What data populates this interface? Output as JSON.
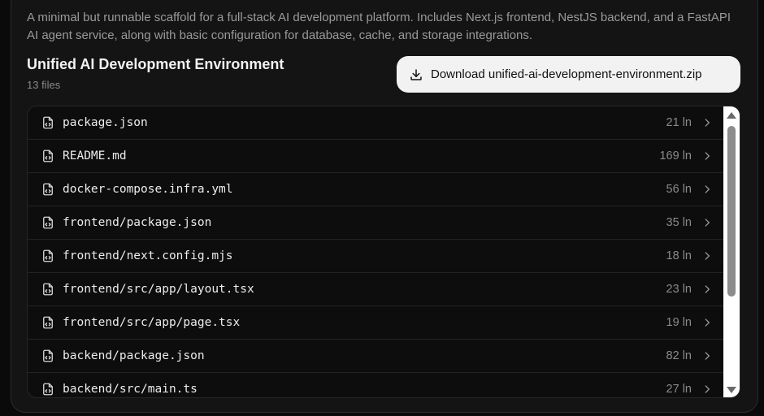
{
  "description": "A minimal but runnable scaffold for a full-stack AI development platform. Includes Next.js frontend, NestJS backend, and a FastAPI AI agent service, along with basic configuration for database, cache, and storage integrations.",
  "project": {
    "title": "Unified AI Development Environment",
    "file_count": "13 files"
  },
  "download_button": {
    "label": "Download unified-ai-development-environment.zip",
    "icon": "download-icon"
  },
  "files": [
    {
      "name": "package.json",
      "lines": "21 ln"
    },
    {
      "name": "README.md",
      "lines": "169 ln"
    },
    {
      "name": "docker-compose.infra.yml",
      "lines": "56 ln"
    },
    {
      "name": "frontend/package.json",
      "lines": "35 ln"
    },
    {
      "name": "frontend/next.config.mjs",
      "lines": "18 ln"
    },
    {
      "name": "frontend/src/app/layout.tsx",
      "lines": "23 ln"
    },
    {
      "name": "frontend/src/app/page.tsx",
      "lines": "19 ln"
    },
    {
      "name": "backend/package.json",
      "lines": "82 ln"
    },
    {
      "name": "backend/src/main.ts",
      "lines": "27 ln"
    }
  ]
}
